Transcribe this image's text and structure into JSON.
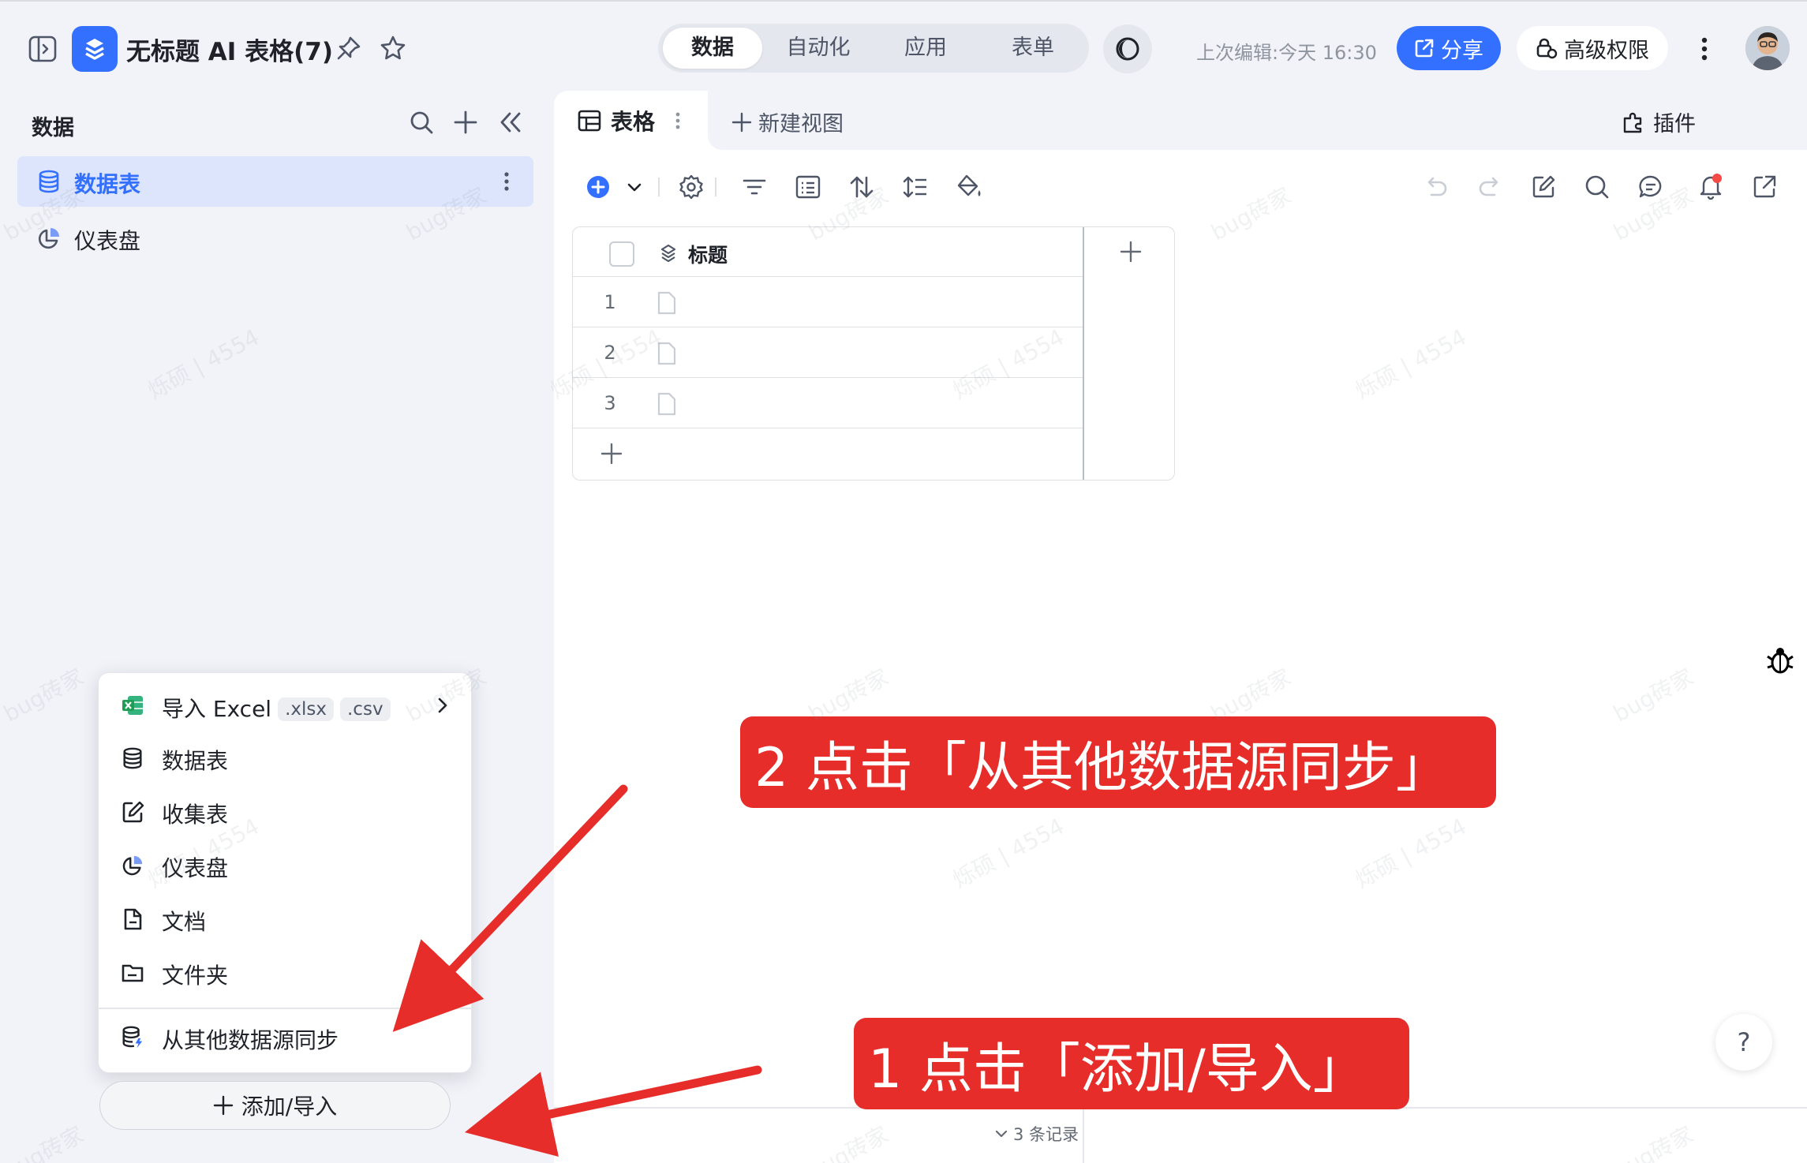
{
  "header": {
    "doc_title": "无标题 AI 表格(7)",
    "mode_tabs": [
      {
        "label": "数据",
        "active": true
      },
      {
        "label": "自动化",
        "active": false
      },
      {
        "label": "应用",
        "active": false
      },
      {
        "label": "表单",
        "active": false
      }
    ],
    "last_edited": "上次编辑:今天 16:30",
    "share_label": "分享",
    "permission_label": "高级权限"
  },
  "sidebar": {
    "title": "数据",
    "items": [
      {
        "label": "数据表",
        "icon": "database-icon",
        "active": true
      },
      {
        "label": "仪表盘",
        "icon": "dashboard-icon",
        "active": false
      }
    ]
  },
  "add_menu": {
    "items": [
      {
        "label": "导入 Excel",
        "icon": "excel-icon",
        "tags": [
          ".xlsx",
          ".csv"
        ],
        "has_submenu": true
      },
      {
        "label": "数据表",
        "icon": "database-icon"
      },
      {
        "label": "收集表",
        "icon": "form-edit-icon"
      },
      {
        "label": "仪表盘",
        "icon": "dashboard-icon"
      },
      {
        "label": "文档",
        "icon": "document-icon"
      },
      {
        "label": "文件夹",
        "icon": "folder-icon"
      },
      {
        "label": "从其他数据源同步",
        "icon": "sync-datasource-icon"
      }
    ]
  },
  "add_import_button": "添加/导入",
  "view": {
    "active_tab": "表格",
    "new_view_label": "新建视图",
    "plugin_label": "插件"
  },
  "grid": {
    "column_title": "标题",
    "rows": [
      "1",
      "2",
      "3"
    ],
    "record_count": "3 条记录"
  },
  "annotations": {
    "step1": "1 点击「添加/导入」",
    "step2": "2 点击「从其他数据源同步」"
  },
  "watermark_texts": [
    "bug砖家",
    "烁硕 | 4554"
  ],
  "help_label": "?",
  "colors": {
    "accent": "#3370ff",
    "annotation_red": "#e62d2a",
    "notification_dot": "#f54a45",
    "excel_green": "#1f9d55"
  }
}
